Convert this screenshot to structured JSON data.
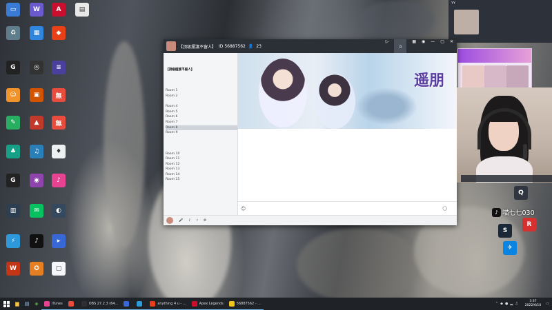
{
  "desktop": {
    "icons": [
      {
        "label": "",
        "color": "#3a7bd5",
        "glyph": "▭"
      },
      {
        "label": "",
        "color": "#6a5acd",
        "glyph": "W"
      },
      {
        "label": "",
        "color": "#c8102e",
        "glyph": "A"
      },
      {
        "label": "",
        "color": "#e8e8e8",
        "glyph": "▤"
      },
      {
        "label": "",
        "color": "#607d8b",
        "glyph": "♻"
      },
      {
        "label": "",
        "color": "#2e86de",
        "glyph": "▦"
      },
      {
        "label": "",
        "color": "#e84118",
        "glyph": "◆"
      },
      {
        "label": "",
        "color": "#222222",
        "glyph": "G"
      },
      {
        "label": "",
        "color": "#333333",
        "glyph": "◎"
      },
      {
        "label": "",
        "color": "#4b3f9e",
        "glyph": "≡"
      },
      {
        "label": "",
        "color": "#f0932b",
        "glyph": "☺"
      },
      {
        "label": "",
        "color": "#d35400",
        "glyph": "▣"
      },
      {
        "label": "",
        "color": "#e74c3c",
        "glyph": "無"
      },
      {
        "label": "",
        "color": "#27ae60",
        "glyph": "✎"
      },
      {
        "label": "",
        "color": "#c0392b",
        "glyph": "▲"
      },
      {
        "label": "",
        "color": "#e74c3c",
        "glyph": "無"
      },
      {
        "label": "",
        "color": "#16a085",
        "glyph": "♣"
      },
      {
        "label": "",
        "color": "#2980b9",
        "glyph": "♫"
      },
      {
        "label": "",
        "color": "#ecf0f1",
        "glyph": "♦"
      },
      {
        "label": "",
        "color": "#222222",
        "glyph": "G"
      },
      {
        "label": "",
        "color": "#8e44ad",
        "glyph": "◉"
      },
      {
        "label": "",
        "color": "#e84393",
        "glyph": "♪"
      },
      {
        "label": "",
        "color": "#2c3e50",
        "glyph": "▥"
      },
      {
        "label": "",
        "color": "#07c160",
        "glyph": "✉"
      },
      {
        "label": "",
        "color": "#34495e",
        "glyph": "◐"
      },
      {
        "label": "",
        "color": "#2d98da",
        "glyph": "⚡"
      },
      {
        "label": "",
        "color": "#111111",
        "glyph": "♪"
      },
      {
        "label": "",
        "color": "#3867d6",
        "glyph": "▸"
      },
      {
        "label": "",
        "color": "#c23616",
        "glyph": "W"
      },
      {
        "label": "",
        "color": "#e67e22",
        "glyph": "✪"
      },
      {
        "label": "",
        "color": "#f5f6fa",
        "glyph": "▢"
      }
    ],
    "right_icons": [
      {
        "label": "",
        "color": "#2f3640",
        "glyph": "Q"
      },
      {
        "label": "",
        "color": "#1b2838",
        "glyph": "S"
      },
      {
        "label": "",
        "color": "#d63031",
        "glyph": "R"
      },
      {
        "label": "",
        "color": "#0984e3",
        "glyph": "✈"
      }
    ],
    "douyin_name": "喵七七030"
  },
  "yy": {
    "title": "【顶级摆渡不留人】",
    "channel_id": "ID 56887562",
    "count": "23",
    "tabs": [],
    "mode": "",
    "mode_hint": "",
    "tree_top": "【顶级摆渡不留人】",
    "tree": [
      {
        "text": "",
        "cls": "",
        "count": ""
      },
      {
        "text": "",
        "cls": "user",
        "count": ""
      },
      {
        "text": "",
        "cls": "",
        "count": ""
      },
      {
        "text": "Room 1",
        "cls": "",
        "count": ""
      },
      {
        "text": "Room 2",
        "cls": "",
        "count": ""
      },
      {
        "text": "",
        "cls": "",
        "count": ""
      },
      {
        "text": "Room 4",
        "cls": "",
        "count": ""
      },
      {
        "text": "Room 5",
        "cls": "",
        "count": ""
      },
      {
        "text": "Room 6",
        "cls": "",
        "count": ""
      },
      {
        "text": "Room 7",
        "cls": "",
        "count": ""
      },
      {
        "text": "Room 8",
        "cls": "hl",
        "count": ""
      },
      {
        "text": "Room 9",
        "cls": "",
        "count": ""
      },
      {
        "text": "",
        "cls": "",
        "count": ""
      },
      {
        "text": "",
        "cls": "",
        "count": ""
      },
      {
        "text": "",
        "cls": "",
        "count": ""
      },
      {
        "text": "Room 10",
        "cls": "",
        "count": ""
      },
      {
        "text": "Room 11",
        "cls": "",
        "count": ""
      },
      {
        "text": "Room 12",
        "cls": "",
        "count": ""
      },
      {
        "text": "Room 13",
        "cls": "",
        "count": ""
      },
      {
        "text": "Room 14",
        "cls": "",
        "count": ""
      },
      {
        "text": "Room 15",
        "cls": "",
        "count": ""
      }
    ],
    "banner_logo": "遥朋",
    "messages": [],
    "bottom": [
      {
        "label": ""
      },
      {
        "label": ""
      },
      {
        "label": ""
      }
    ],
    "bottom_right": [
      "",
      ""
    ]
  },
  "mini": {
    "header": "YY",
    "name": "",
    "sub": ""
  },
  "promo": {
    "band": ""
  },
  "cam": {
    "strip": ""
  },
  "taskbar": {
    "apps": [
      {
        "label": "iTunes",
        "color": "#e84393"
      },
      {
        "label": "",
        "color": "#e74c3c"
      },
      {
        "label": "OBS 27.2.3 (64...",
        "color": "#302e31"
      },
      {
        "label": "",
        "color": "#3867d6"
      },
      {
        "label": "",
        "color": "#2d98da"
      },
      {
        "label": "anything 4 u - ...",
        "color": "#e84118"
      },
      {
        "label": "Apex Legends",
        "color": "#c8102e"
      },
      {
        "label": "56887562 - ...",
        "color": "#f0c419"
      }
    ],
    "time": "3:37",
    "date": "2022/6/10",
    "lang": ""
  }
}
